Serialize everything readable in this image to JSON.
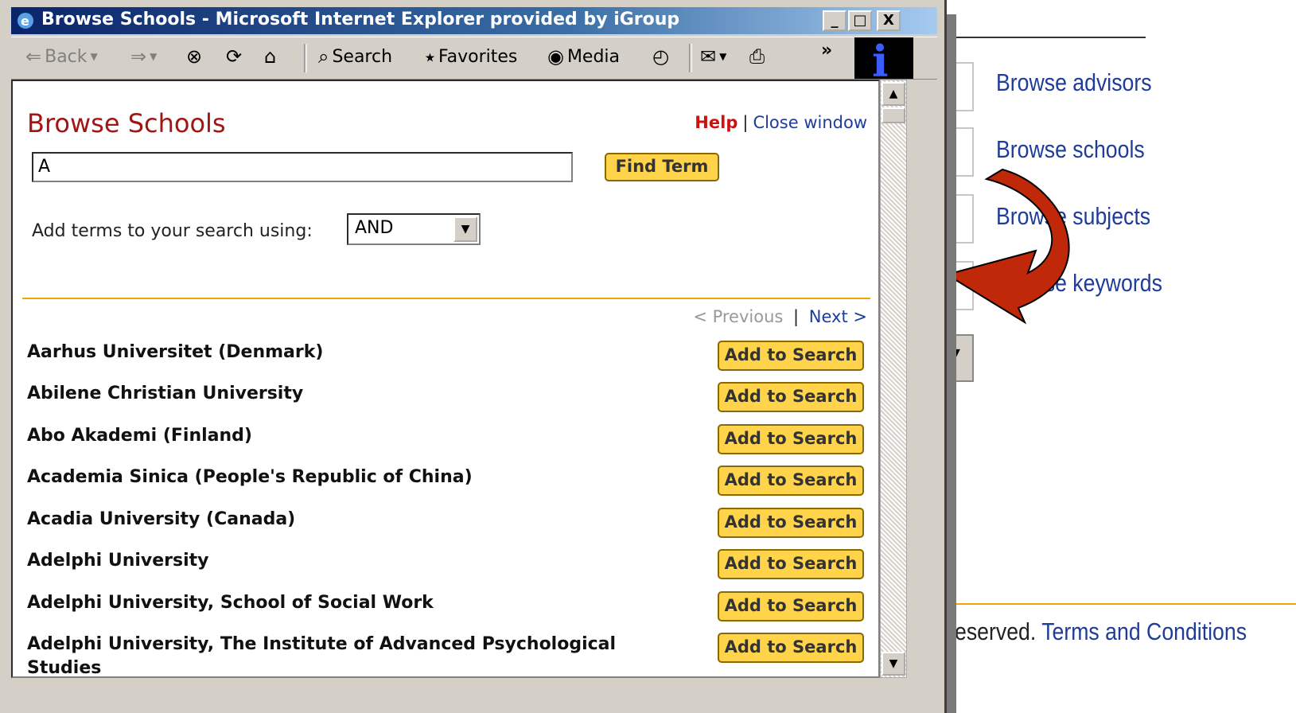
{
  "window": {
    "title": "Browse Schools - Microsoft Internet Explorer provided by iGroup",
    "controls": {
      "minimize": "_",
      "maximize": "□",
      "close": "X"
    }
  },
  "toolbar": {
    "back": "Back",
    "search": "Search",
    "favorites": "Favorites",
    "media": "Media",
    "overflow": "»"
  },
  "page": {
    "title": "Browse Schools",
    "help": "Help",
    "separator": "|",
    "close_window": "Close window",
    "search_value": "A",
    "find_button": "Find Term",
    "add_terms_label": "Add terms to your search using:",
    "operator": "AND",
    "previous": "< Previous",
    "next": "Next >",
    "add_button_label": "Add to Search",
    "schools": [
      "Aarhus Universitet (Denmark)",
      "Abilene Christian University",
      "Abo Akademi (Finland)",
      "Academia Sinica (People's Republic of China)",
      "Acadia University (Canada)",
      "Adelphi University",
      "Adelphi University, School of Social Work",
      "Adelphi University, The Institute of Advanced Psychological Studies"
    ]
  },
  "background": {
    "links": [
      "Browse advisors",
      "Browse schools",
      "Browse subjects",
      "Browse keywords"
    ],
    "footer_text": "eserved.",
    "footer_link": "Terms and Conditions"
  },
  "colors": {
    "title_red": "#a31515",
    "link_blue": "#1f3c9a",
    "button_yellow": "#ffd34a",
    "divider_orange": "#f2a40a",
    "arrow_red": "#c0280a"
  }
}
